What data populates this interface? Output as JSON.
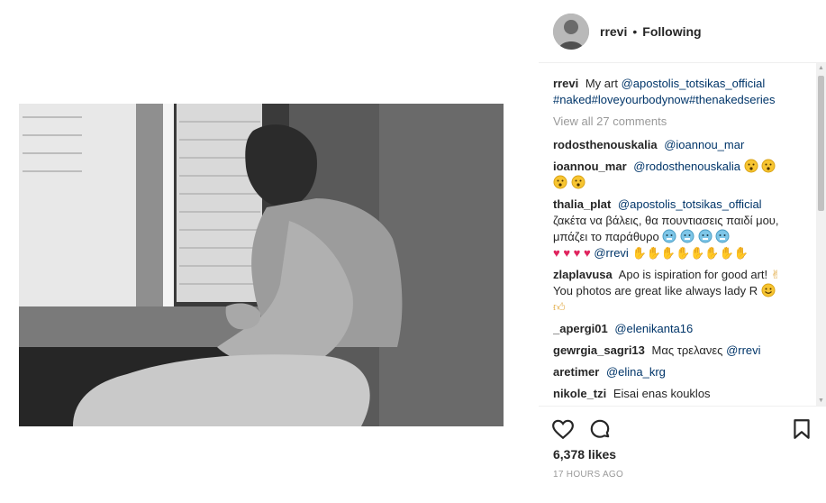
{
  "post": {
    "username": "rrevi",
    "separator": "•",
    "follow_status": "Following",
    "caption": {
      "user": "rrevi",
      "text": "My art",
      "mention": "@apostolis_totsikas_official",
      "hashtags": "#naked#loveyourbodynow#thenakedseries"
    },
    "view_all": "View all 27 comments",
    "likes": "6,378 likes",
    "timestamp": "17 HOURS AGO"
  },
  "comments": [
    {
      "user": "rodosthenouskalia",
      "mention": "@ioannou_mar",
      "text": ""
    },
    {
      "user": "ioannou_mar",
      "mention": "@rodosthenouskalia",
      "text": ""
    },
    {
      "user": "thalia_plat",
      "mention": "@apostolis_totsikas_official",
      "text": "ζακέτα να βάλεις, θα πουντιασεις παιδί μου, μπάζει το παράθυρο",
      "mention2": "@rrevi"
    },
    {
      "user": "zlaplavusa",
      "text": "Apo is ispiration for good art!",
      "text2": "You photos are great like always lady R"
    },
    {
      "user": "_apergi01",
      "mention": "@elenikanta16"
    },
    {
      "user": "gewrgia_sagri13",
      "text": "Μας τρελανες",
      "mention": "@rrevi"
    },
    {
      "user": "aretimer",
      "mention": "@elina_krg"
    },
    {
      "user": "nikole_tzi",
      "text": "Eisai enas kouklos"
    }
  ],
  "icons": {
    "like": "heart-icon",
    "comment": "comment-bubble-icon",
    "save": "bookmark-icon"
  },
  "colors": {
    "link": "#003569",
    "muted": "#999999",
    "text": "#262626",
    "heart_red": "#e0245e"
  }
}
